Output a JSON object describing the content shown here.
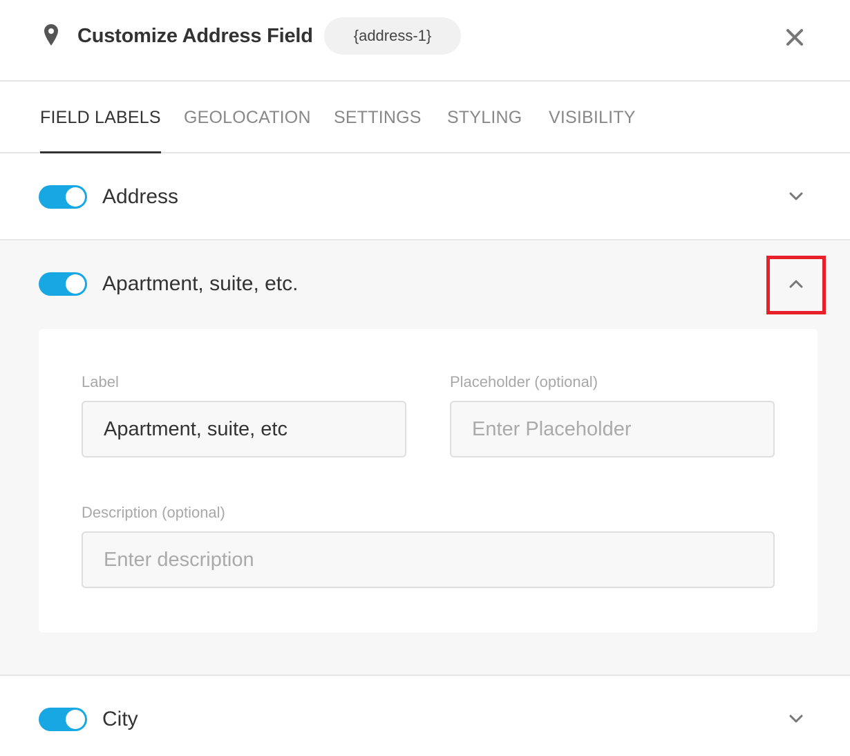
{
  "header": {
    "title": "Customize Address Field",
    "tag": "{address-1}",
    "icon": "map-pin-icon",
    "close_icon": "close-icon"
  },
  "tabs": [
    {
      "label": "FIELD LABELS",
      "active": true
    },
    {
      "label": "GEOLOCATION",
      "active": false
    },
    {
      "label": "SETTINGS",
      "active": false
    },
    {
      "label": "STYLING",
      "active": false
    },
    {
      "label": "VISIBILITY",
      "active": false
    }
  ],
  "rows": {
    "address": {
      "label": "Address",
      "enabled": true,
      "expanded": false
    },
    "apartment": {
      "label": "Apartment, suite, etc.",
      "enabled": true,
      "expanded": true
    },
    "city": {
      "label": "City",
      "enabled": true,
      "expanded": false
    }
  },
  "apartment_panel": {
    "label_title": "Label",
    "label_value": "Apartment, suite, etc",
    "placeholder_title": "Placeholder (optional)",
    "placeholder_placeholder": "Enter Placeholder",
    "description_title": "Description (optional)",
    "description_placeholder": "Enter description"
  },
  "colors": {
    "toggle_on": "#17a8e3",
    "highlight": "#e8202a",
    "active_tab": "#333333",
    "inactive_tab": "#888888"
  }
}
